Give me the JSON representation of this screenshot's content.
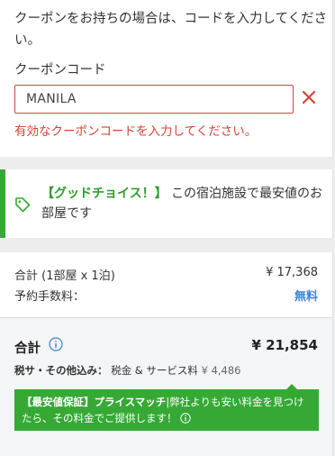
{
  "coupon": {
    "intro": "クーポンをお持ちの場合は、コードを入力してください。",
    "label": "クーポンコード",
    "value": "MANILA",
    "error": "有効なクーポンコードを入力してください。"
  },
  "promo": {
    "highlight": "【グッドチョイス！】",
    "text": "この宿泊施設で最安値のお部屋です"
  },
  "summary": {
    "subtotal_label": "合計 (1部屋 x 1泊)",
    "subtotal_value": "¥ 17,368",
    "fee_label": "予約手数料：",
    "fee_value": "無料",
    "total_label": "合計",
    "total_value": "¥ 21,854",
    "tax_bold": "税サ・その他込み：",
    "tax_text": "税金 & サービス料",
    "tax_amount": "¥ 4,486",
    "price_match_title": "【最安値保証】プライスマッチ",
    "price_match_text": "弊社よりも安い料金を見つけたら、その料金でご提供します！"
  },
  "colors": {
    "error": "#d64433",
    "promo_green": "#35a935",
    "free_blue": "#3b84d6"
  }
}
